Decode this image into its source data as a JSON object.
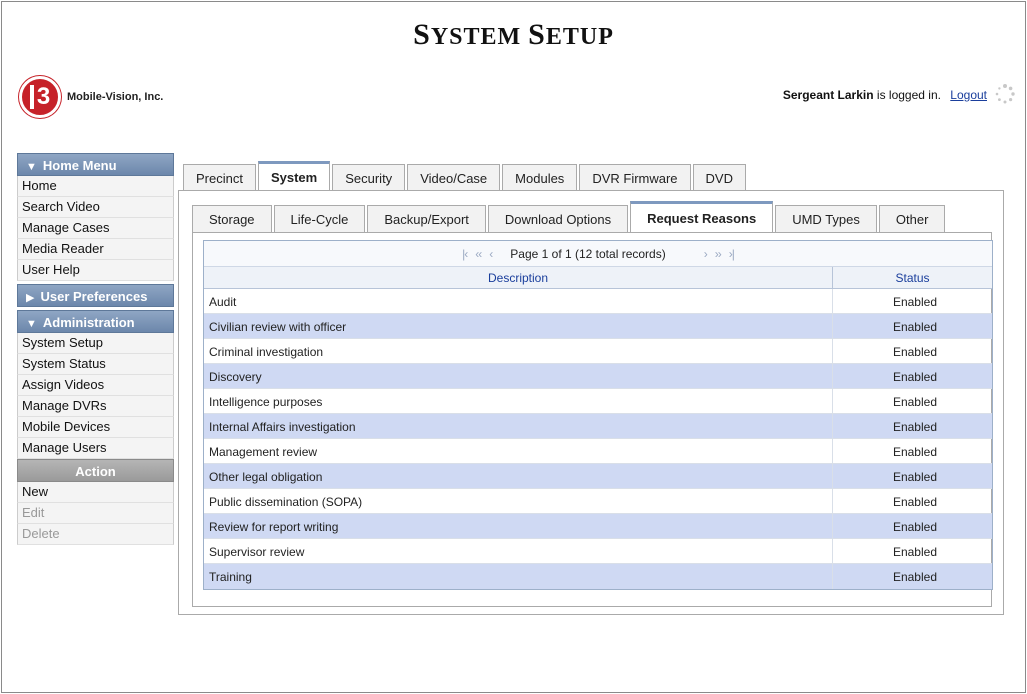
{
  "header": {
    "title_big_s": "S",
    "title_rest_1": "YSTEM ",
    "title_big_s2": "S",
    "title_rest_2": "ETUP",
    "logo_mark": "3",
    "logo_text": "Mobile-Vision, Inc.",
    "user_name": "Sergeant Larkin",
    "login_suffix": "is logged in.",
    "logout_label": "Logout"
  },
  "sidebar": {
    "home_menu": {
      "label": "Home Menu",
      "items": [
        "Home",
        "Search Video",
        "Manage Cases",
        "Media Reader",
        "User Help"
      ]
    },
    "user_prefs": {
      "label": "User Preferences"
    },
    "administration": {
      "label": "Administration",
      "items": [
        "System Setup",
        "System Status",
        "Assign Videos",
        "Manage DVRs",
        "Mobile Devices",
        "Manage Users"
      ]
    },
    "action": {
      "label": "Action",
      "items": [
        "New",
        "Edit",
        "Delete"
      ]
    }
  },
  "top_tabs": [
    "Precinct",
    "System",
    "Security",
    "Video/Case",
    "Modules",
    "DVR Firmware",
    "DVD"
  ],
  "sub_tabs": [
    "Storage",
    "Life-Cycle",
    "Backup/Export",
    "Download Options",
    "Request Reasons",
    "UMD Types",
    "Other"
  ],
  "grid": {
    "pager_text": "Page 1 of 1 (12 total records)",
    "col_description": "Description",
    "col_status": "Status",
    "rows": [
      {
        "description": "Audit",
        "status": "Enabled"
      },
      {
        "description": "Civilian review with officer",
        "status": "Enabled"
      },
      {
        "description": "Criminal investigation",
        "status": "Enabled"
      },
      {
        "description": "Discovery",
        "status": "Enabled"
      },
      {
        "description": "Intelligence purposes",
        "status": "Enabled"
      },
      {
        "description": "Internal Affairs investigation",
        "status": "Enabled"
      },
      {
        "description": "Management review",
        "status": "Enabled"
      },
      {
        "description": "Other legal obligation",
        "status": "Enabled"
      },
      {
        "description": "Public dissemination (SOPA)",
        "status": "Enabled"
      },
      {
        "description": "Review for report writing",
        "status": "Enabled"
      },
      {
        "description": "Supervisor review",
        "status": "Enabled"
      },
      {
        "description": "Training",
        "status": "Enabled"
      }
    ]
  },
  "colors": {
    "accent": "#7e99bf",
    "row_alt": "#cfd9f3",
    "logo_red": "#c62229",
    "link": "#1a3e9c"
  }
}
